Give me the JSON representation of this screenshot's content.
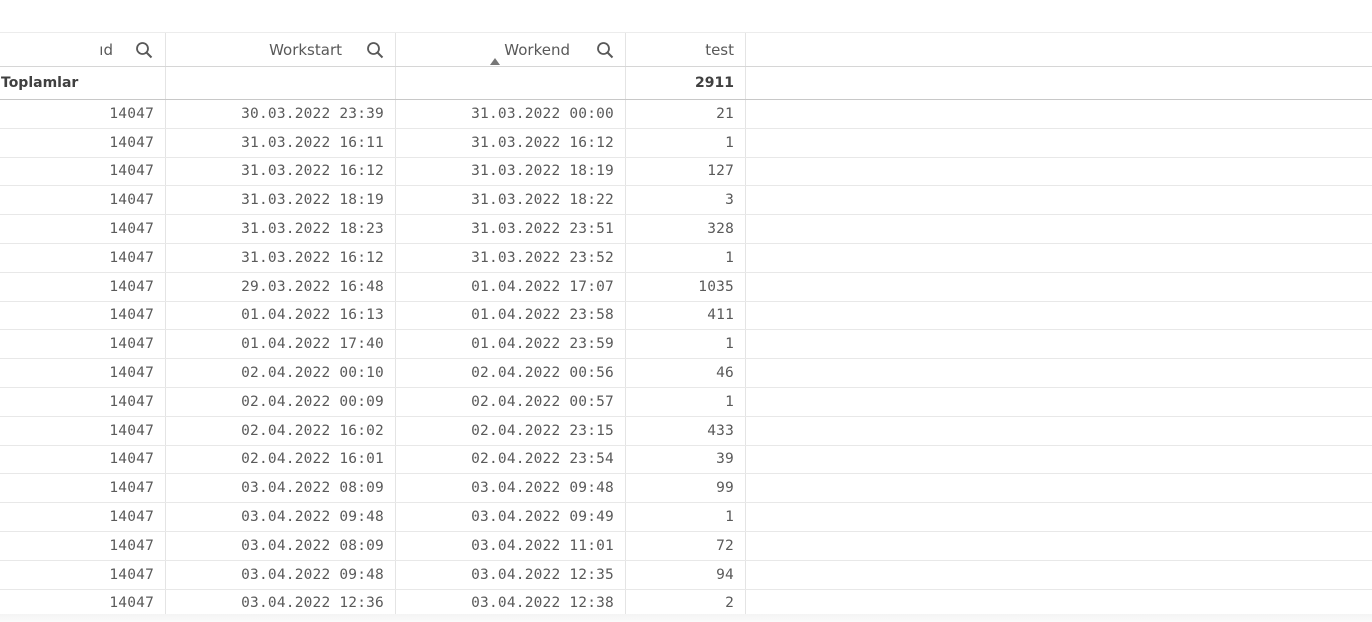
{
  "columns": {
    "id": "ıd",
    "workstart": "Workstart",
    "workend": "Workend",
    "test": "test"
  },
  "totals": {
    "label": "Toplamlar",
    "test": "2911"
  },
  "rows": [
    {
      "id": "14047",
      "workstart": "30.03.2022 23:39",
      "workend": "31.03.2022 00:00",
      "test": "21"
    },
    {
      "id": "14047",
      "workstart": "31.03.2022 16:11",
      "workend": "31.03.2022 16:12",
      "test": "1"
    },
    {
      "id": "14047",
      "workstart": "31.03.2022 16:12",
      "workend": "31.03.2022 18:19",
      "test": "127"
    },
    {
      "id": "14047",
      "workstart": "31.03.2022 18:19",
      "workend": "31.03.2022 18:22",
      "test": "3"
    },
    {
      "id": "14047",
      "workstart": "31.03.2022 18:23",
      "workend": "31.03.2022 23:51",
      "test": "328"
    },
    {
      "id": "14047",
      "workstart": "31.03.2022 16:12",
      "workend": "31.03.2022 23:52",
      "test": "1"
    },
    {
      "id": "14047",
      "workstart": "29.03.2022 16:48",
      "workend": "01.04.2022 17:07",
      "test": "1035"
    },
    {
      "id": "14047",
      "workstart": "01.04.2022 16:13",
      "workend": "01.04.2022 23:58",
      "test": "411"
    },
    {
      "id": "14047",
      "workstart": "01.04.2022 17:40",
      "workend": "01.04.2022 23:59",
      "test": "1"
    },
    {
      "id": "14047",
      "workstart": "02.04.2022 00:10",
      "workend": "02.04.2022 00:56",
      "test": "46"
    },
    {
      "id": "14047",
      "workstart": "02.04.2022 00:09",
      "workend": "02.04.2022 00:57",
      "test": "1"
    },
    {
      "id": "14047",
      "workstart": "02.04.2022 16:02",
      "workend": "02.04.2022 23:15",
      "test": "433"
    },
    {
      "id": "14047",
      "workstart": "02.04.2022 16:01",
      "workend": "02.04.2022 23:54",
      "test": "39"
    },
    {
      "id": "14047",
      "workstart": "03.04.2022 08:09",
      "workend": "03.04.2022 09:48",
      "test": "99"
    },
    {
      "id": "14047",
      "workstart": "03.04.2022 09:48",
      "workend": "03.04.2022 09:49",
      "test": "1"
    },
    {
      "id": "14047",
      "workstart": "03.04.2022 08:09",
      "workend": "03.04.2022 11:01",
      "test": "72"
    },
    {
      "id": "14047",
      "workstart": "03.04.2022 09:48",
      "workend": "03.04.2022 12:35",
      "test": "94"
    },
    {
      "id": "14047",
      "workstart": "03.04.2022 12:36",
      "workend": "03.04.2022 12:38",
      "test": "2"
    }
  ],
  "sort": {
    "column": "workend",
    "direction": "ascending",
    "icon": "sort-ascending-icon"
  },
  "icons": {
    "search": "search-icon"
  },
  "colors": {
    "text": "#404040",
    "grid": "#e4e4e4",
    "icon": "#595959"
  }
}
